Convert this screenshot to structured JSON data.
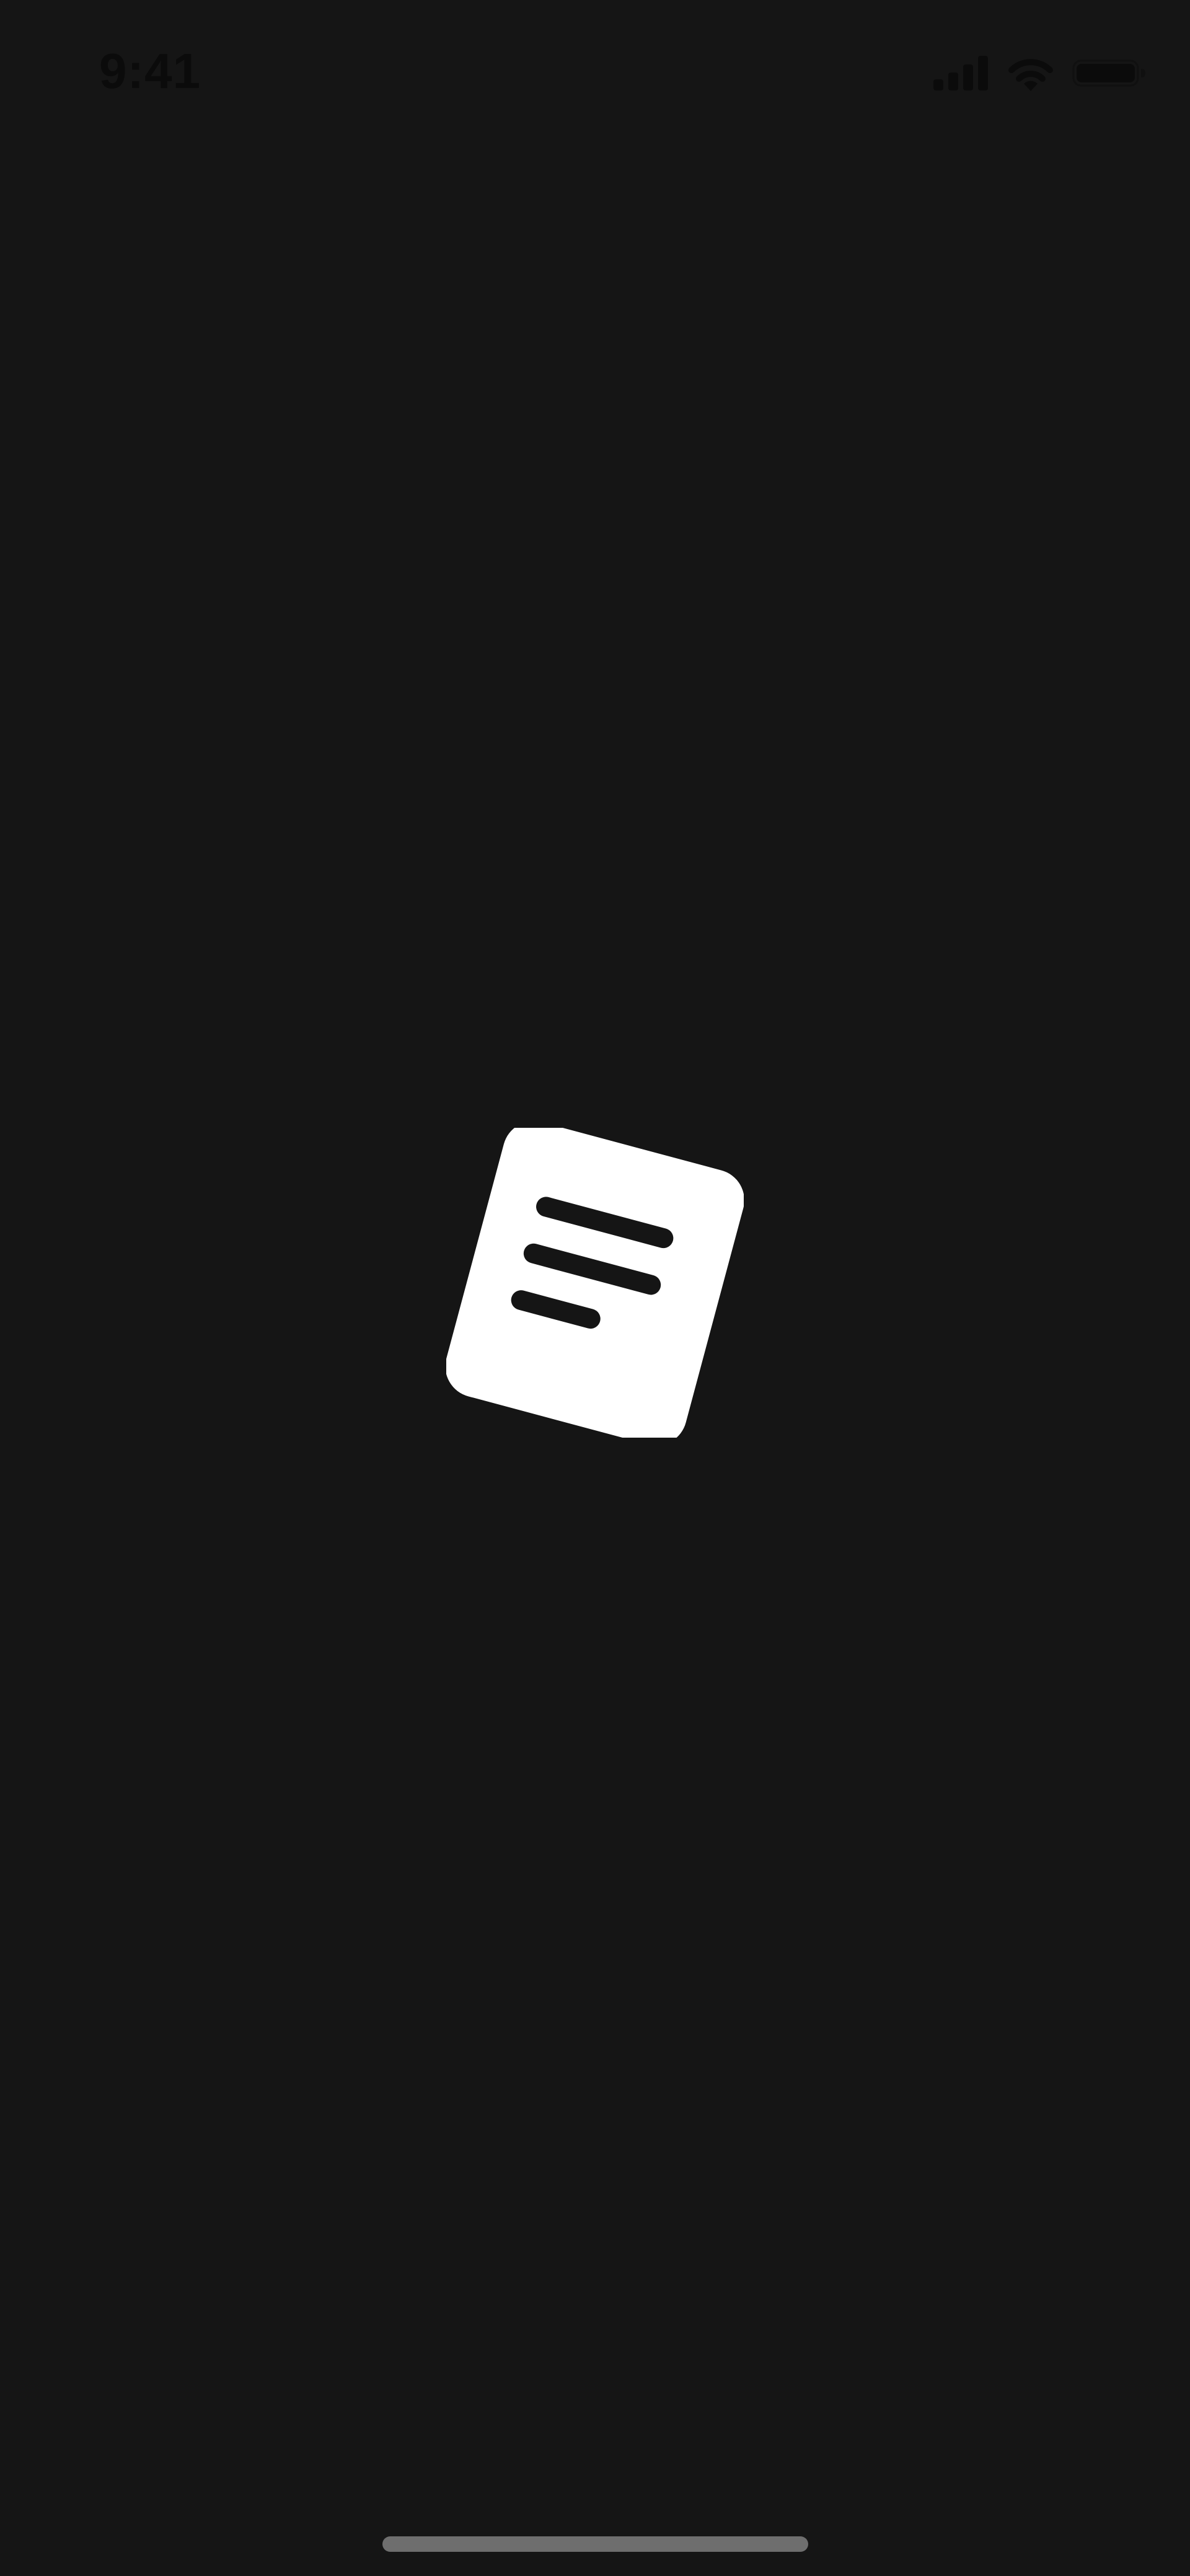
{
  "status_bar": {
    "time": "9:41",
    "signal_icon": "cellular-signal-icon",
    "wifi_icon": "wifi-icon",
    "battery_icon": "battery-icon"
  },
  "splash": {
    "logo_icon": "document-notes-icon",
    "background_color": "#151515",
    "logo_color": "#ffffff"
  },
  "home_indicator": {
    "color": "#6e6e6e"
  }
}
